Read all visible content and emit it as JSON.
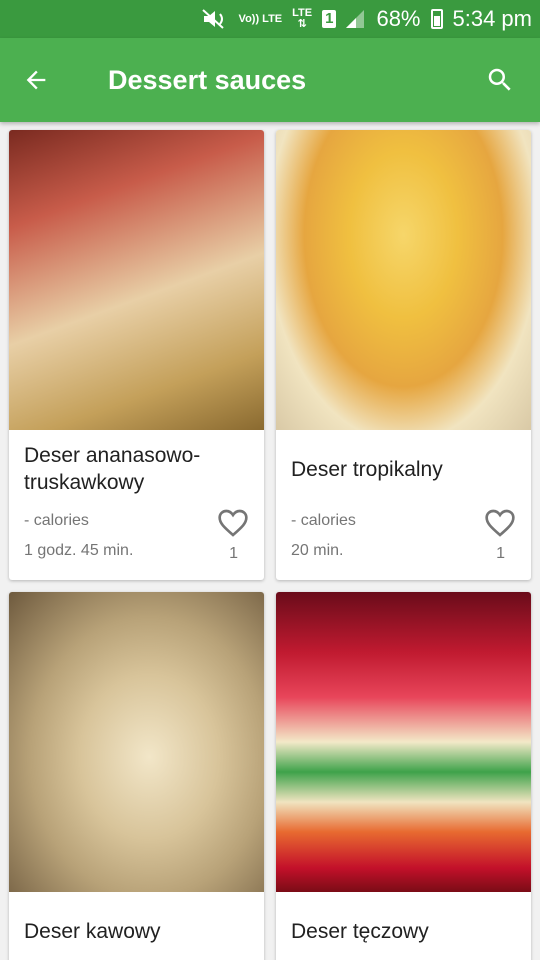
{
  "status_bar": {
    "volte_label": "Vo)) LTE",
    "lte_label": "LTE",
    "sim_slot": "1",
    "battery": "68%",
    "time": "5:34 pm"
  },
  "app_bar": {
    "title": "Dessert sauces",
    "back_icon": "arrow-left-icon",
    "search_icon": "search-icon"
  },
  "recipes": [
    {
      "title": "Deser ananasowo-truskawkowy",
      "calories": "- calories",
      "time": "1 godz. 45 min.",
      "likes": "1"
    },
    {
      "title": "Deser tropikalny",
      "calories": "- calories",
      "time": "20 min.",
      "likes": "1"
    },
    {
      "title": "Deser kawowy"
    },
    {
      "title": "Deser tęczowy"
    }
  ],
  "colors": {
    "status_bar": "#3a9a3f",
    "app_bar": "#4cb050",
    "background": "#f1f1f1"
  }
}
